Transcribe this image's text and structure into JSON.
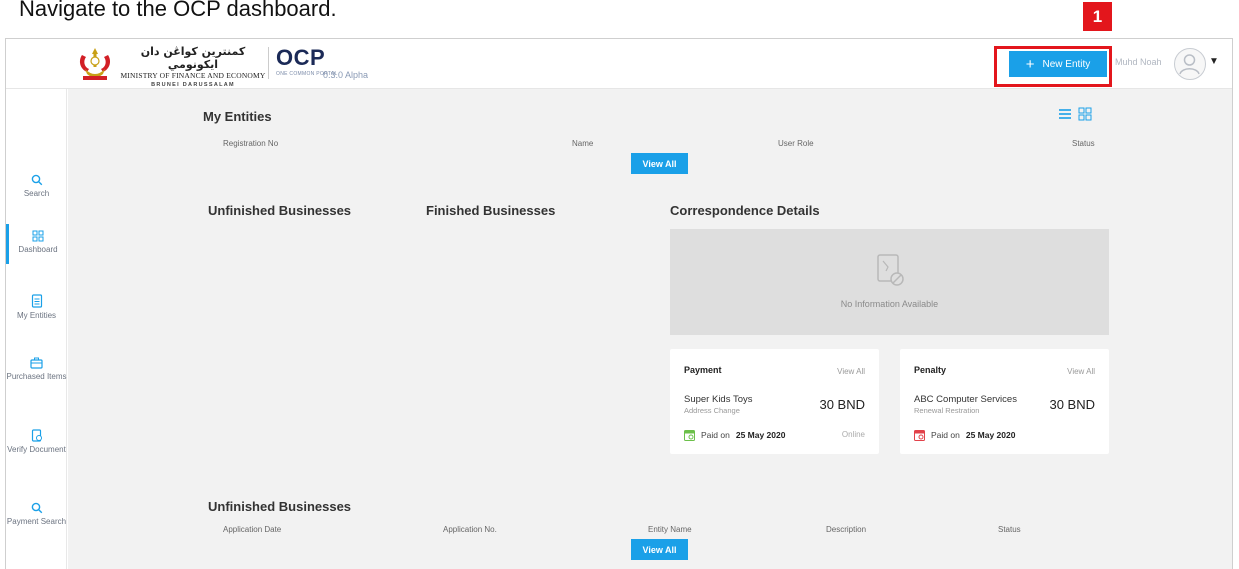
{
  "instruction": "Navigate to the OCP dashboard.",
  "callout_number": "1",
  "header": {
    "ministry_arabic": "کمنترين کواڠن دان ايکونومي",
    "ministry_english": "MINISTRY OF FINANCE AND ECONOMY",
    "ministry_country": "BRUNEI DARUSSALAM",
    "app_name": "OCP",
    "app_subtitle": "ONE COMMON PORTAL",
    "version": "0.3.0 Alpha",
    "new_entity_label": "New Entity",
    "user_name": "Muhd Noah"
  },
  "sidebar": {
    "items": [
      {
        "label": "Search",
        "icon": "search-icon"
      },
      {
        "label": "Dashboard",
        "icon": "dashboard-icon",
        "active": true
      },
      {
        "label": "My Entities",
        "icon": "document-icon"
      },
      {
        "label": "Purchased Items",
        "icon": "briefcase-icon"
      },
      {
        "label": "Verify Document",
        "icon": "verify-document-icon"
      },
      {
        "label": "Payment Search",
        "icon": "search-icon"
      }
    ]
  },
  "my_entities": {
    "title": "My Entities",
    "columns": [
      "Registration No",
      "Name",
      "User Role",
      "Status"
    ],
    "view_all": "View All"
  },
  "sections": {
    "unfinished": "Unfinished Businesses",
    "finished": "Finished Businesses",
    "correspondence": "Correspondence Details",
    "no_info": "No Information Available"
  },
  "payment_card": {
    "title": "Payment",
    "view_all": "View All",
    "item": "Super Kids Toys",
    "item_sub": "Address Change",
    "amount": "30 BND",
    "paid_label": "Paid on",
    "paid_date": "25 May 2020",
    "method": "Online"
  },
  "penalty_card": {
    "title": "Penalty",
    "view_all": "View All",
    "item": "ABC Computer Services",
    "item_sub": "Renewal Restration",
    "amount": "30 BND",
    "paid_label": "Paid on",
    "paid_date": "25 May 2020"
  },
  "unfinished_table": {
    "title": "Unfinished Businesses",
    "columns": [
      "Application Date",
      "Application No.",
      "Entity Name",
      "Description",
      "Status"
    ],
    "view_all": "View All"
  },
  "colors": {
    "accent": "#1aa0e8",
    "callout": "#e3161c",
    "brand": "#1b2a57"
  }
}
